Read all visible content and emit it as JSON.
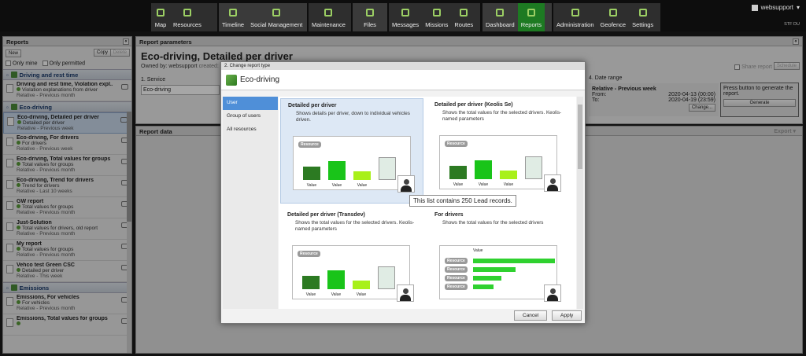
{
  "topnav": {
    "group1": [
      "Map",
      "Resources"
    ],
    "group2": [
      "Timeline",
      "Social Management"
    ],
    "group3": [
      "Maintenance"
    ],
    "group4": [
      "Files"
    ],
    "group5": [
      "Messages",
      "Missions",
      "Routes"
    ],
    "group6": [
      "Dashboard",
      "Reports"
    ],
    "group7": [
      "Administration",
      "Geofence",
      "Settings"
    ],
    "active": "Reports",
    "user": "websupport",
    "build": "STF DU"
  },
  "left": {
    "title": "Reports",
    "collapse": "«",
    "new_btn": "New",
    "copy_btn": "Copy",
    "delete_btn": "Delete",
    "only_mine": "Only mine",
    "only_permitted": "Only permitted",
    "groups": [
      {
        "name": "Driving and rest time"
      },
      {
        "name": "Eco-driving"
      },
      {
        "name": "Emissions"
      }
    ],
    "items_g1": [
      {
        "title": "Driving and rest time, Violation expl...",
        "sub": "Violation explanations from driver",
        "rel": "Relative - Previous month"
      }
    ],
    "items_g2": [
      {
        "title": "Eco-driving, Detailed per driver",
        "sub": "Detailed per driver",
        "rel": "Relative - Previous week"
      },
      {
        "title": "Eco-driving, For drivers",
        "sub": "For drivers",
        "rel": "Relative - Previous week"
      },
      {
        "title": "Eco-driving, Total values for groups",
        "sub": "Total values for groups",
        "rel": "Relative - Previous month"
      },
      {
        "title": "Eco-driving, Trend for drivers",
        "sub": "Trend for drivers",
        "rel": "Relative - Last 10 weeks"
      },
      {
        "title": "GW report",
        "sub": "Total values for groups",
        "rel": "Relative - Previous month"
      },
      {
        "title": "Just-Solution",
        "sub": "Total values for drivers, old report",
        "rel": "Relative - Previous month"
      },
      {
        "title": "My report",
        "sub": "Total values for groups",
        "rel": "Relative - Previous month"
      },
      {
        "title": "Vehco test Green CSC",
        "sub": "Detailed per driver",
        "rel": "Relative - This week"
      }
    ],
    "items_g3": [
      {
        "title": "Emissions, For vehicles",
        "sub": "For vehicles",
        "rel": "Relative - Previous month"
      },
      {
        "title": "Emissions, Total values for groups",
        "sub": "",
        "rel": ""
      }
    ]
  },
  "params": {
    "header": "Report parameters",
    "title": "Eco-driving, Detailed per driver",
    "owned": "Owned by: websupport",
    "created": "created:",
    "service_label": "1. Service",
    "service_value": "Eco-driving",
    "share": "Share report",
    "schedule": "Schedule",
    "date_label": "4. Date range",
    "date_mode": "Relative - Previous week",
    "from_label": "From:",
    "from_value": "2020-04-13 (00:00)",
    "to_label": "To:",
    "to_value": "2020-04-19 (23:59)",
    "change_btn": "Change...",
    "gen_text": "Press button to generate the report.",
    "gen_btn": "Generate"
  },
  "rdata": {
    "header": "Report data",
    "export": "Export ▾"
  },
  "dialog": {
    "step": "2. Change report type",
    "title": "Eco-driving",
    "left_items": [
      "User",
      "Group of users",
      "All resources"
    ],
    "cards": [
      {
        "title": "Detailed per driver",
        "desc": "Shows details per driver, down to individual vehicles driven."
      },
      {
        "title": "Detailed per driver (Keolis Se)",
        "desc": "Shows the total values for the selected drivers. Keolis-named parameters"
      },
      {
        "title": "Detailed per driver (Transdev)",
        "desc": "Shows the total values for the selected drivers. Keolis-named parameters"
      },
      {
        "title": "For drivers",
        "desc": "Shows the total values for the selected drivers"
      }
    ],
    "resource_label": "Resource",
    "value_label": "Value",
    "tooltip": "This list contains 250 Lead records.",
    "cancel": "Cancel",
    "apply": "Apply"
  },
  "colors": {
    "accent": "#1d7a22",
    "selection": "#4f8fd8",
    "bar_dark": "#2c7a22",
    "bar_green": "#19c419",
    "bar_lime": "#a8f01a",
    "bar_pale": "#e0ece4"
  }
}
